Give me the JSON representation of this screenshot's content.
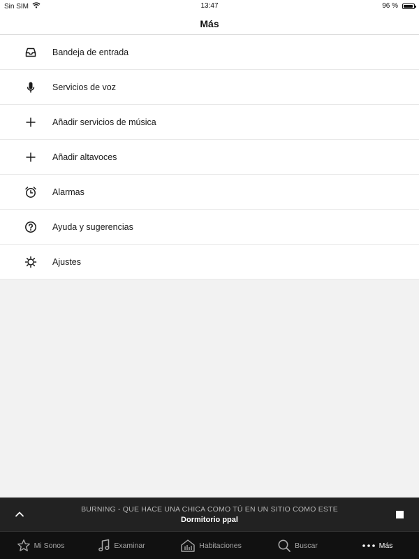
{
  "status_bar": {
    "carrier": "Sin SIM",
    "time": "13:47",
    "battery_percent": "96 %",
    "battery_level": 0.96
  },
  "header": {
    "title": "Más"
  },
  "menu": {
    "items": [
      {
        "label": "Bandeja de entrada",
        "icon": "inbox-icon"
      },
      {
        "label": "Servicios de voz",
        "icon": "microphone-icon"
      },
      {
        "label": "Añadir servicios de música",
        "icon": "plus-icon"
      },
      {
        "label": "Añadir altavoces",
        "icon": "plus-icon"
      },
      {
        "label": "Alarmas",
        "icon": "alarm-clock-icon"
      },
      {
        "label": "Ayuda y sugerencias",
        "icon": "help-icon"
      },
      {
        "label": "Ajustes",
        "icon": "settings-icon"
      }
    ]
  },
  "now_playing": {
    "track": "BURNING - QUE HACE UNA CHICA COMO TÚ EN UN SITIO COMO ESTE",
    "room": "Dormitorio ppal"
  },
  "tabs": [
    {
      "label": "Mi Sonos",
      "icon": "star-icon"
    },
    {
      "label": "Examinar",
      "icon": "music-note-icon"
    },
    {
      "label": "Habitaciones",
      "icon": "rooms-icon"
    },
    {
      "label": "Buscar",
      "icon": "search-icon"
    },
    {
      "label": "Más",
      "icon": "more-dots-icon",
      "active": true
    }
  ],
  "colors": {
    "now_playing_bg": "#222222",
    "tab_bar_bg": "#111111",
    "background": "#f2f2f2"
  }
}
